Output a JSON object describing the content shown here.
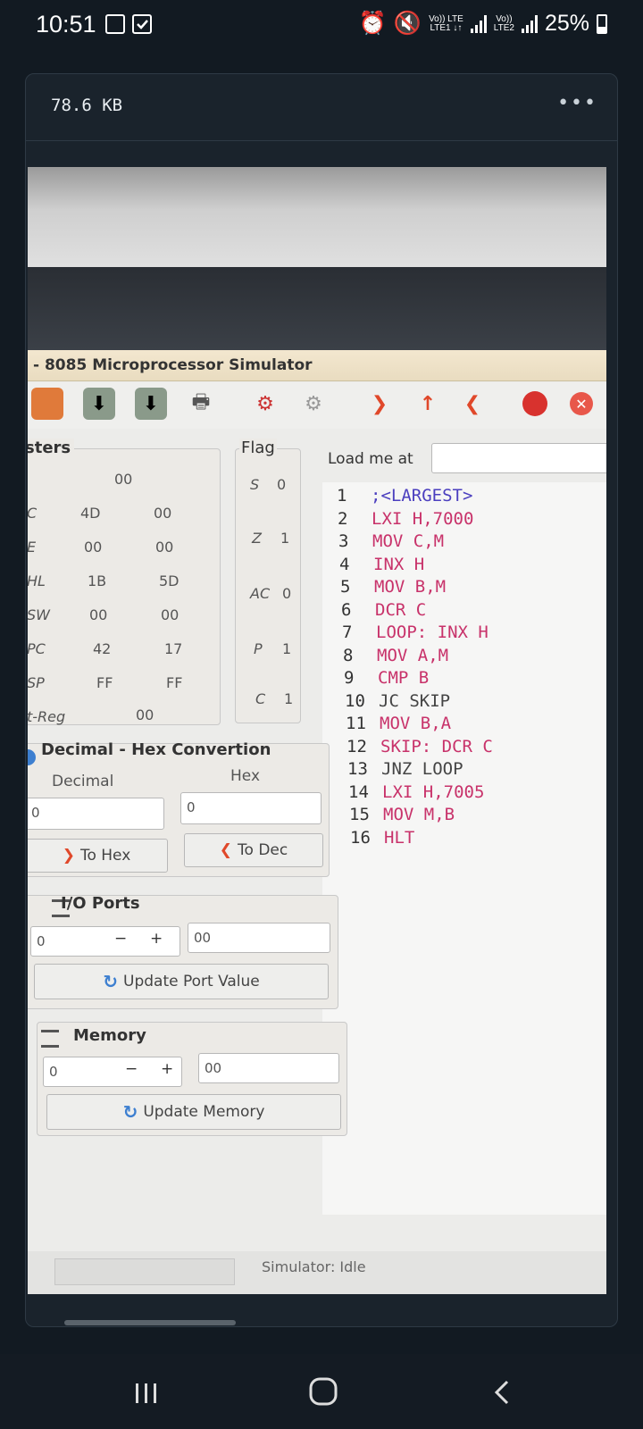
{
  "status_bar": {
    "time": "10:51",
    "net1_top": "Vo)) LTE",
    "net1_bottom": "LTE1 ↓↑",
    "net2_top": "Vo))",
    "net2_bottom": "LTE2",
    "battery": "25%"
  },
  "viewer": {
    "file_size": "78.6 KB",
    "more_label": "•••"
  },
  "simulator": {
    "window_title": "- 8085 Microprocessor Simulator",
    "registers": {
      "title": "sters",
      "accumulator": "00",
      "rows": [
        {
          "name": "C",
          "hi": "4D",
          "lo": "00"
        },
        {
          "name": "E",
          "hi": "00",
          "lo": "00"
        },
        {
          "name": "HL",
          "hi": "1B",
          "lo": "5D"
        },
        {
          "name": "SW",
          "hi": "00",
          "lo": "00"
        },
        {
          "name": "PC",
          "hi": "42",
          "lo": "17"
        },
        {
          "name": "SP",
          "hi": "FF",
          "lo": "FF"
        }
      ],
      "int_reg_label": "t-Reg",
      "int_reg_value": "00"
    },
    "flags": {
      "title": "Flag",
      "items": [
        {
          "name": "S",
          "value": "0"
        },
        {
          "name": "Z",
          "value": "1"
        },
        {
          "name": "AC",
          "value": "0"
        },
        {
          "name": "P",
          "value": "1"
        },
        {
          "name": "C",
          "value": "1"
        }
      ]
    },
    "load_label": "Load me at",
    "load_value": "",
    "code_lines": [
      {
        "n": "1",
        "t": ";<LARGEST>",
        "c": "#4b3fbf"
      },
      {
        "n": "2",
        "t": "LXI H,7000",
        "c": "#c8326a"
      },
      {
        "n": "3",
        "t": "MOV C,M",
        "c": "#c8326a"
      },
      {
        "n": "4",
        "t": "INX H",
        "c": "#c8326a"
      },
      {
        "n": "5",
        "t": "MOV B,M",
        "c": "#c8326a"
      },
      {
        "n": "6",
        "t": "DCR C",
        "c": "#c8326a"
      },
      {
        "n": "7",
        "t": "LOOP: INX H",
        "c": "#c8326a"
      },
      {
        "n": "8",
        "t": "MOV A,M",
        "c": "#c8326a"
      },
      {
        "n": "9",
        "t": "CMP B",
        "c": "#c8326a"
      },
      {
        "n": "10",
        "t": "JC SKIP",
        "c": "#444444"
      },
      {
        "n": "11",
        "t": "MOV B,A",
        "c": "#c8326a"
      },
      {
        "n": "12",
        "t": "SKIP: DCR C",
        "c": "#c8326a"
      },
      {
        "n": "13",
        "t": "JNZ LOOP",
        "c": "#444444"
      },
      {
        "n": "14",
        "t": "LXI H,7005",
        "c": "#c8326a"
      },
      {
        "n": "15",
        "t": "MOV M,B",
        "c": "#c8326a"
      },
      {
        "n": "16",
        "t": "HLT",
        "c": "#c8326a"
      }
    ],
    "conversion": {
      "title": "Decimal - Hex Convertion",
      "decimal_label": "Decimal",
      "hex_label": "Hex",
      "decimal_value": "0",
      "hex_value": "0",
      "to_hex": "To Hex",
      "to_dec": "To Dec"
    },
    "io_ports": {
      "title": "I/O Ports",
      "port_value": "0",
      "minus": "−",
      "plus": "+",
      "data_value": "00",
      "update_label": "Update Port Value"
    },
    "memory": {
      "title": "Memory",
      "address_value": "0",
      "minus": "−",
      "plus": "+",
      "data_value": "00",
      "update_label": "Update Memory"
    },
    "status_text": "Simulator: Idle"
  }
}
